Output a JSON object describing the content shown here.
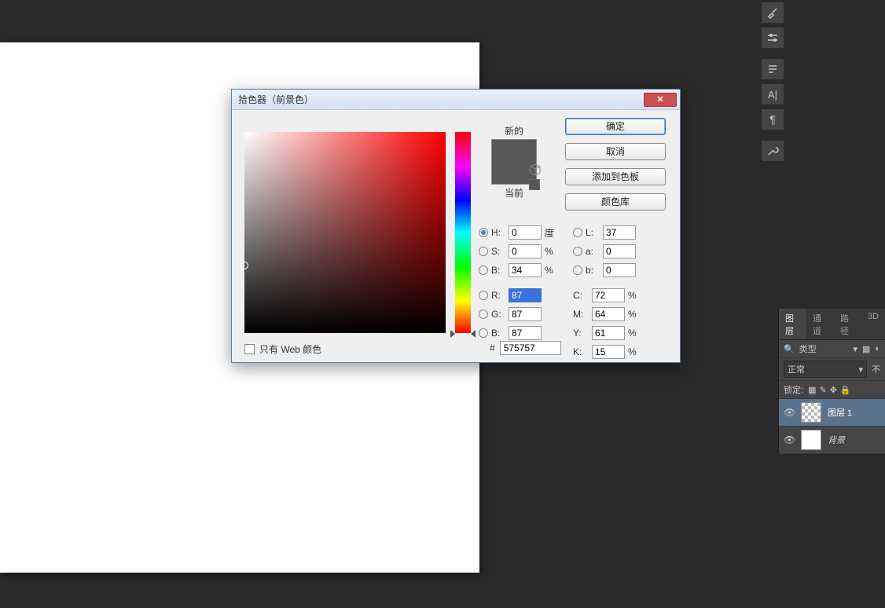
{
  "canvas": {},
  "right_icons": [
    "brush",
    "adjust",
    "paragraph",
    "text",
    "pilcrow",
    "wrench"
  ],
  "layers_panel": {
    "tabs": [
      "图层",
      "通道",
      "路径",
      "3D"
    ],
    "active_tab": 0,
    "type_label": "类型",
    "blend_mode": "正常",
    "opacity_label": "不",
    "lock_label": "锁定:",
    "layers": [
      {
        "name": "图层 1",
        "selected": true,
        "checker": true,
        "italic": false
      },
      {
        "name": "背景",
        "selected": false,
        "checker": false,
        "italic": true
      }
    ]
  },
  "dialog": {
    "title": "拾色器（前景色）",
    "new_label": "新的",
    "current_label": "当前",
    "buttons": {
      "ok": "确定",
      "cancel": "取消",
      "add": "添加到色板",
      "lib": "颜色库"
    },
    "hsb": {
      "h_label": "H:",
      "h_value": "0",
      "h_unit": "度",
      "s_label": "S:",
      "s_value": "0",
      "s_unit": "%",
      "b_label": "B:",
      "b_value": "34",
      "b_unit": "%"
    },
    "rgb": {
      "r_label": "R:",
      "r_value": "87",
      "g_label": "G:",
      "g_value": "87",
      "b_label": "B:",
      "b_value": "87"
    },
    "lab": {
      "l_label": "L:",
      "l_value": "37",
      "a_label": "a:",
      "a_value": "0",
      "b_label": "b:",
      "b_value": "0"
    },
    "cmyk": {
      "c_label": "C:",
      "c_value": "72",
      "c_unit": "%",
      "m_label": "M:",
      "m_value": "64",
      "m_unit": "%",
      "y_label": "Y:",
      "y_value": "61",
      "y_unit": "%",
      "k_label": "K:",
      "k_value": "15",
      "k_unit": "%"
    },
    "hex_prefix": "#",
    "hex_value": "575757",
    "web_only": "只有 Web 颜色"
  }
}
